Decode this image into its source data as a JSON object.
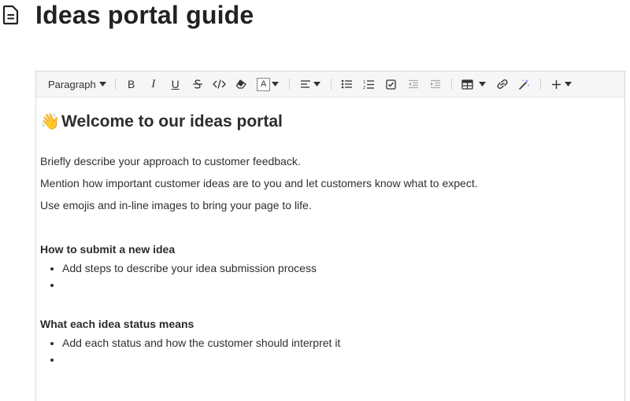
{
  "page": {
    "title": "Ideas portal guide"
  },
  "toolbar": {
    "block_style": "Paragraph",
    "buttons": [
      {
        "name": "bold-icon"
      },
      {
        "name": "italic-icon"
      },
      {
        "name": "underline-icon"
      },
      {
        "name": "strikethrough-icon"
      },
      {
        "name": "code-icon"
      },
      {
        "name": "eraser-icon"
      },
      {
        "name": "text-color-icon"
      },
      {
        "name": "align-left-icon"
      },
      {
        "name": "bullet-list-icon"
      },
      {
        "name": "numbered-list-icon"
      },
      {
        "name": "checklist-icon"
      },
      {
        "name": "outdent-icon"
      },
      {
        "name": "indent-icon"
      },
      {
        "name": "table-icon"
      },
      {
        "name": "link-icon"
      },
      {
        "name": "magic-wand-icon"
      },
      {
        "name": "plus-icon"
      }
    ],
    "bold_label": "B",
    "italic_label": "I",
    "underline_label": "U",
    "text_color_label": "A"
  },
  "content": {
    "heading_emoji": "👋",
    "heading": "Welcome to our ideas portal",
    "paragraphs": [
      "Briefly describe your approach to customer feedback.",
      "Mention how important customer ideas are to you and let customers know what to expect.",
      "Use emojis and in-line images to bring your page to life."
    ],
    "sections": [
      {
        "title": "How to submit a new idea",
        "items": [
          "Add steps to describe your idea submission process",
          ""
        ]
      },
      {
        "title": "What each idea status means",
        "items": [
          "Add each status and how the customer should interpret it",
          ""
        ]
      }
    ]
  }
}
